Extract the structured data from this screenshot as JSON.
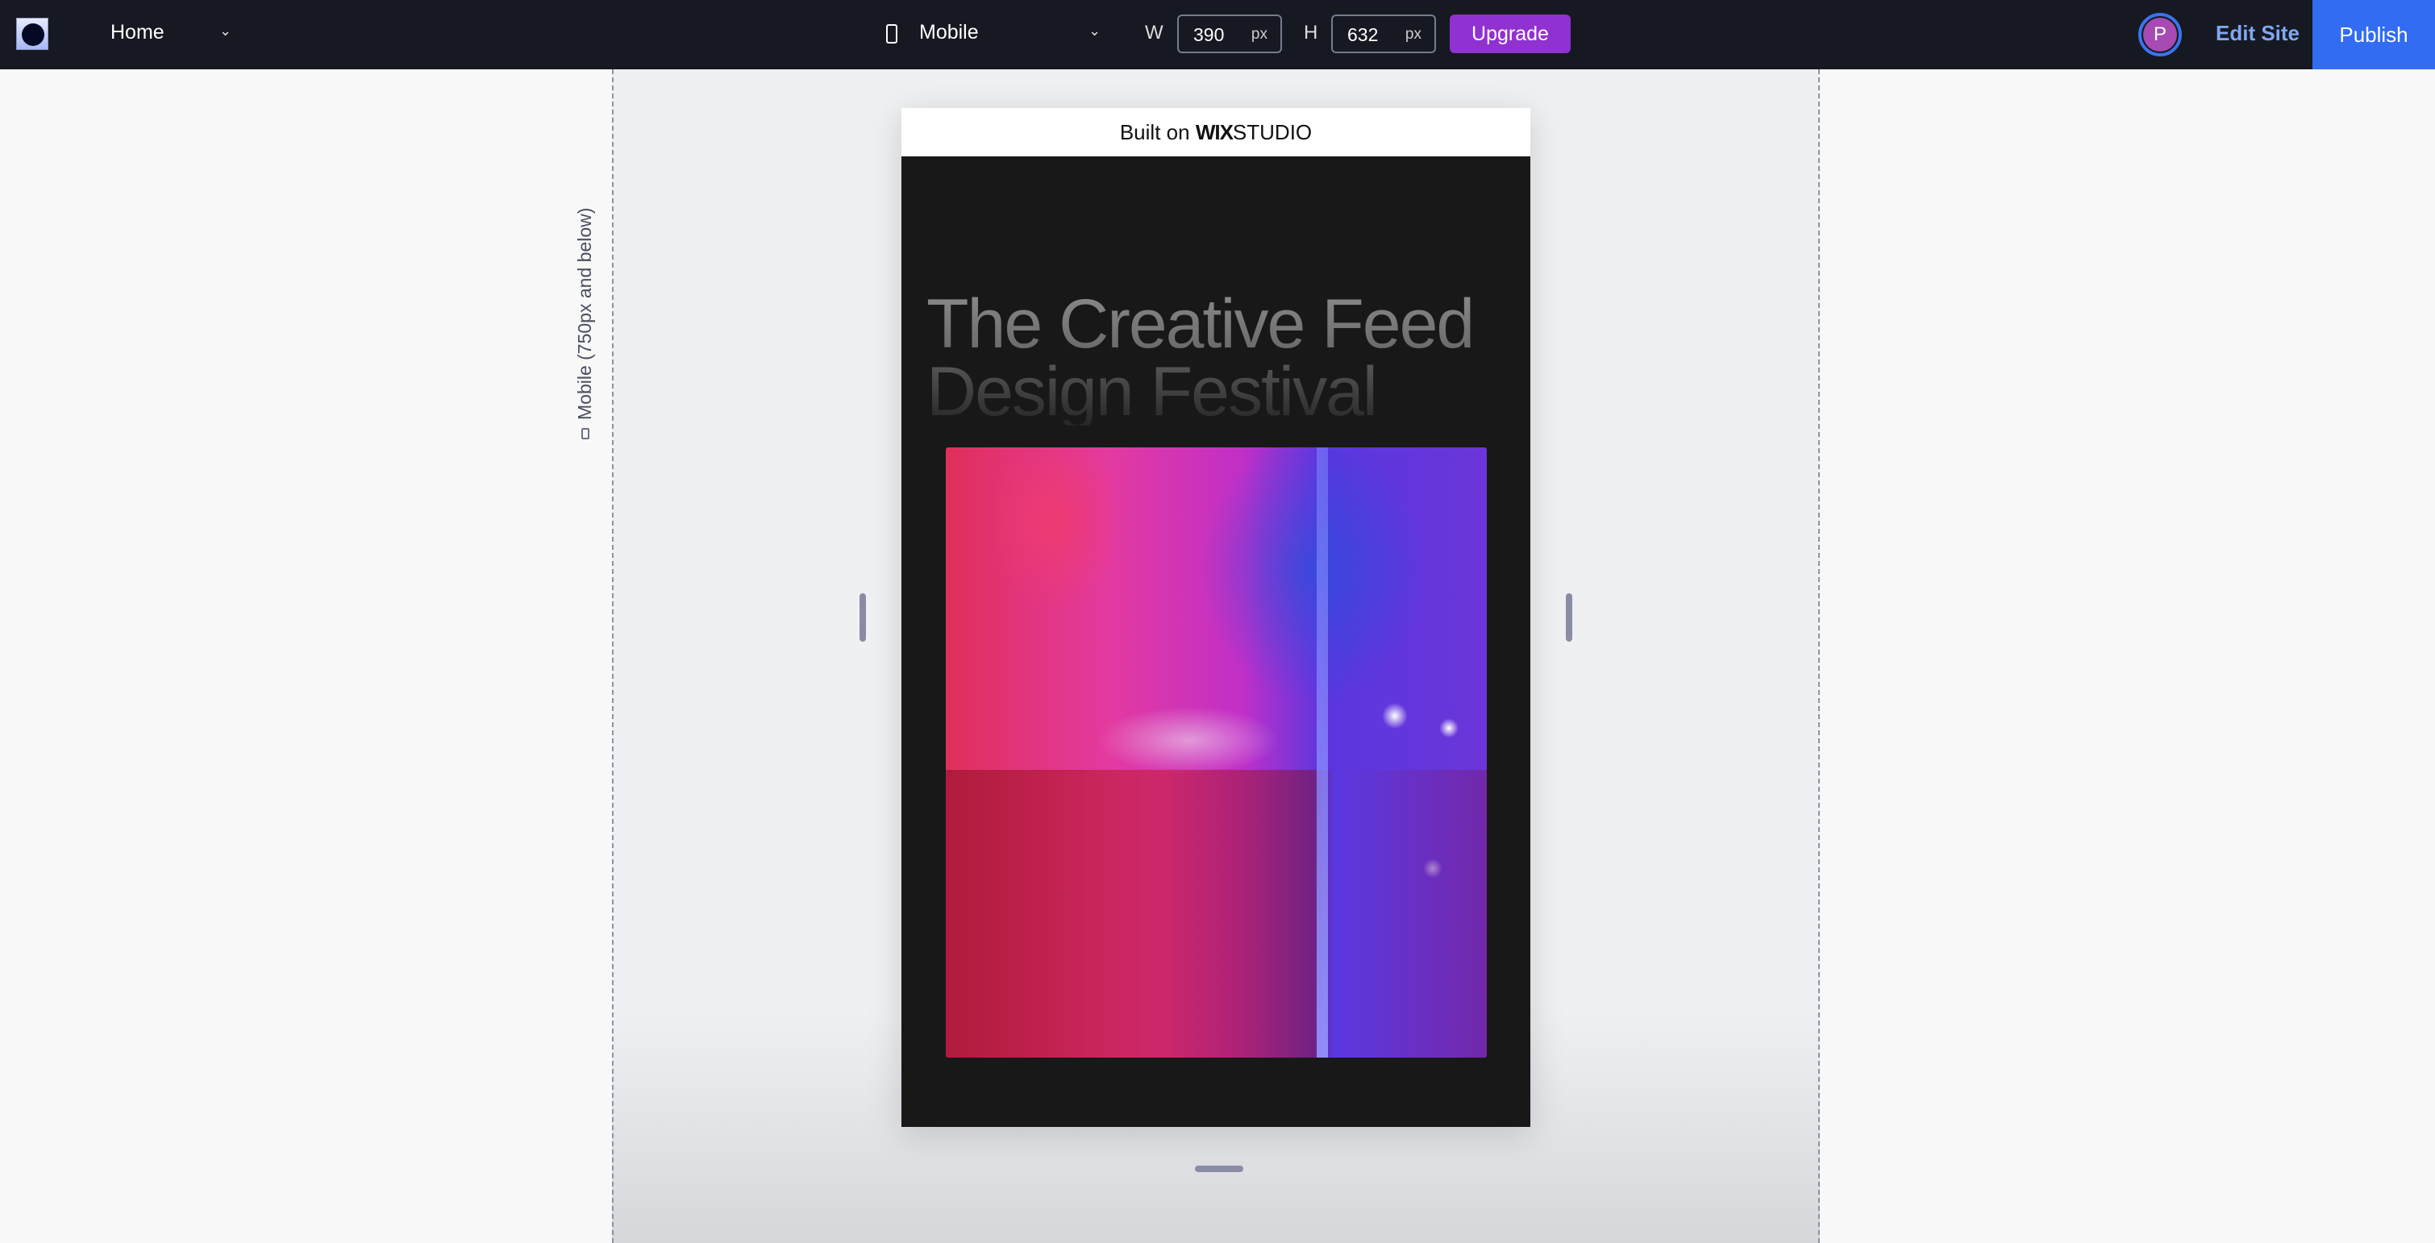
{
  "topbar": {
    "page_selector": "Home",
    "device": "Mobile",
    "width_label": "W",
    "width_value": "390",
    "width_unit": "px",
    "height_label": "H",
    "height_value": "632",
    "height_unit": "px",
    "upgrade_label": "Upgrade",
    "avatar_initial": "P",
    "edit_site_label": "Edit Site",
    "publish_label": "Publish"
  },
  "canvas": {
    "breakpoint_label": "Mobile (750px and below)"
  },
  "site": {
    "banner_prefix": "Built on",
    "banner_brand": "WIX",
    "banner_suffix": "STUDIO",
    "headline_line1": "The Creative Feed",
    "headline_line2": "Design Festival",
    "hero_image_alt": "People looking up in neon pink and purple light"
  },
  "colors": {
    "topbar_bg": "#161921",
    "upgrade": "#9131d1",
    "publish": "#316cf2",
    "edit_site": "#7fa8f2",
    "avatar": "#a64ab4"
  }
}
